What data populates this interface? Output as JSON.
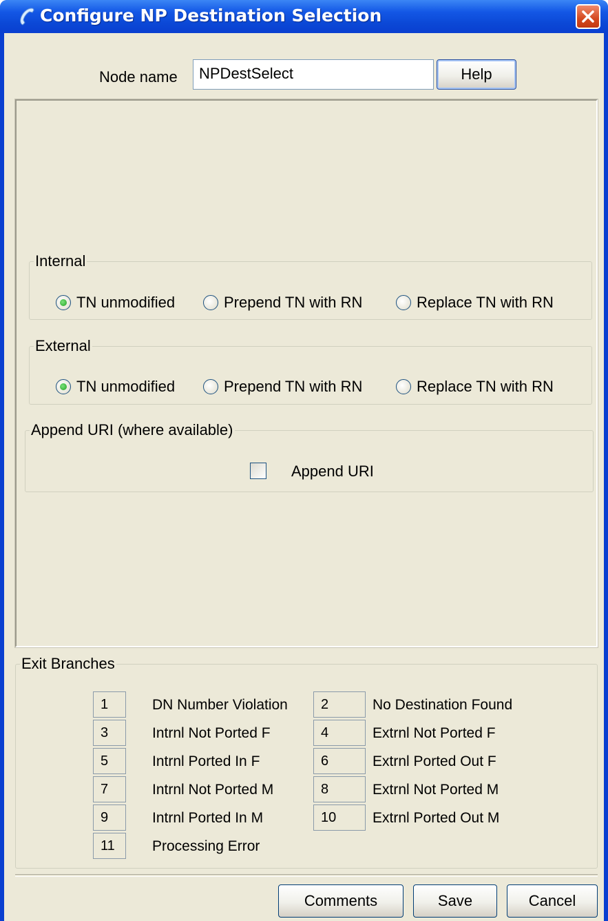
{
  "window": {
    "title": "Configure NP Destination Selection",
    "icon": "phone-icon",
    "close_icon": "close-icon"
  },
  "node": {
    "label": "Node name",
    "value": "NPDestSelect",
    "help_label": "Help"
  },
  "internal": {
    "legend": "Internal",
    "options": [
      "TN unmodified",
      "Prepend TN with RN",
      "Replace TN with RN"
    ],
    "selected": "TN unmodified"
  },
  "external": {
    "legend": "External",
    "options": [
      "TN unmodified",
      "Prepend TN with RN",
      "Replace TN with RN"
    ],
    "selected": "TN unmodified"
  },
  "append_uri": {
    "legend": "Append URI (where available)",
    "label": "Append URI",
    "checked": false
  },
  "exit_branches": {
    "legend": "Exit Branches",
    "items": [
      {
        "num": "1",
        "label": "DN Number Violation"
      },
      {
        "num": "2",
        "label": "No Destination Found"
      },
      {
        "num": "3",
        "label": "Intrnl Not Ported F"
      },
      {
        "num": "4",
        "label": "Extrnl Not Ported F"
      },
      {
        "num": "5",
        "label": "Intrnl Ported In F"
      },
      {
        "num": "6",
        "label": "Extrnl Ported Out F"
      },
      {
        "num": "7",
        "label": "Intrnl Not Ported M"
      },
      {
        "num": "8",
        "label": "Extrnl Not Ported M"
      },
      {
        "num": "9",
        "label": "Intrnl Ported In M"
      },
      {
        "num": "10",
        "label": "Extrnl Ported Out M"
      },
      {
        "num": "11",
        "label": "Processing Error"
      }
    ]
  },
  "buttons": {
    "comments": "Comments",
    "save": "Save",
    "cancel": "Cancel"
  },
  "colors": {
    "titlebar": "#0a3fd0",
    "dialog_bg": "#ece9d8",
    "close_button": "#d4491f",
    "radio_selected": "#21a121"
  }
}
